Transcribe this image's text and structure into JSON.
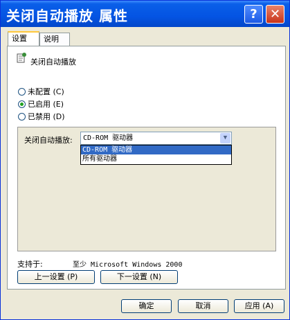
{
  "window": {
    "title": "关闭自动播放 属性",
    "help_glyph": "?",
    "close_glyph": "✕"
  },
  "tabs": [
    {
      "label": "设置"
    },
    {
      "label": "说明"
    }
  ],
  "policy": {
    "name": "关闭自动播放"
  },
  "options": [
    {
      "label": "未配置 (C)",
      "checked": false
    },
    {
      "label": "已启用 (E)",
      "checked": true
    },
    {
      "label": "已禁用 (D)",
      "checked": false
    }
  ],
  "setting": {
    "label": "关闭自动播放:",
    "selected": "CD-ROM 驱动器",
    "options": [
      "CD-ROM 驱动器",
      "所有驱动器"
    ],
    "arrow_glyph": "▼"
  },
  "supported": {
    "label": "支持于:",
    "value": "至少 Microsoft Windows 2000"
  },
  "nav_buttons": {
    "prev": "上一设置 (P)",
    "next": "下一设置 (N)"
  },
  "dialog_buttons": {
    "ok": "确定",
    "cancel": "取消",
    "apply": "应用 (A)"
  },
  "colors": {
    "titlebar": "#0454e3",
    "selection": "#316ac5",
    "tab_accent": "#ffc83c"
  }
}
